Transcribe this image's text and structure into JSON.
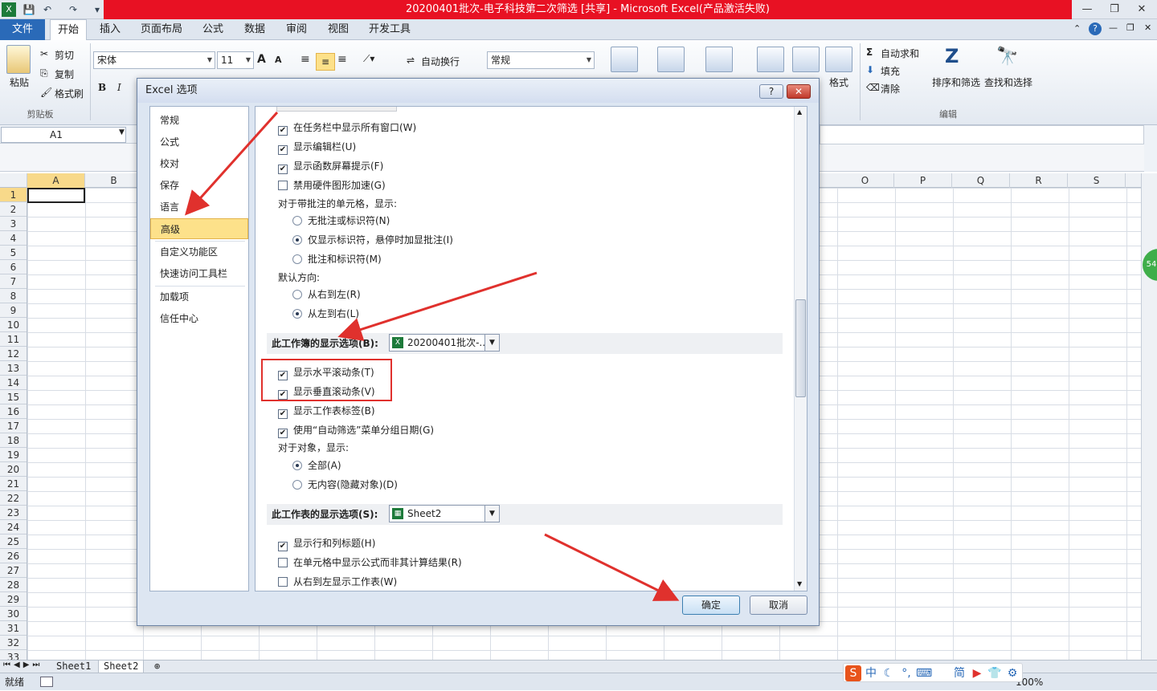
{
  "window": {
    "title": "20200401批次-电子科技第二次筛选  [共享] - Microsoft Excel(产品激活失败)"
  },
  "ribbon": {
    "tabs": [
      "文件",
      "开始",
      "插入",
      "页面布局",
      "公式",
      "数据",
      "审阅",
      "视图",
      "开发工具"
    ],
    "clipboard": {
      "paste": "粘贴",
      "cut": "剪切",
      "copy": "复制",
      "format_painter": "格式刷",
      "group": "剪贴板"
    },
    "font": {
      "name": "宋体",
      "size": "11",
      "bold": "B",
      "italic": "I"
    },
    "alignment": {
      "wrap_text": "自动换行"
    },
    "number": {
      "format": "常规"
    },
    "cells": {
      "format": "格式"
    },
    "editing": {
      "autosum": "自动求和",
      "fill": "填充",
      "clear": "清除",
      "sort_filter": "排序和筛选",
      "find_select": "查找和选择",
      "group": "编辑"
    }
  },
  "formula_bar": {
    "name_box": "A1"
  },
  "sheet": {
    "columns_left": [
      "A",
      "B"
    ],
    "columns_right": [
      "O",
      "P",
      "Q",
      "R",
      "S"
    ],
    "rows": [
      "1",
      "2",
      "3",
      "4",
      "5",
      "6",
      "7",
      "8",
      "9",
      "10",
      "11",
      "12",
      "13",
      "14",
      "15",
      "16",
      "17",
      "18",
      "19",
      "20",
      "21",
      "22",
      "23",
      "24",
      "25",
      "26",
      "27",
      "28",
      "29",
      "30",
      "31",
      "32",
      "33"
    ],
    "tabs": [
      "Sheet1",
      "Sheet2"
    ]
  },
  "status": {
    "ready": "就绪",
    "zoom": "100%"
  },
  "dialog": {
    "title": "Excel 选项",
    "help_button": "?",
    "close_button": "✕",
    "nav": [
      "常规",
      "公式",
      "校对",
      "保存",
      "语言",
      "高级",
      "自定义功能区",
      "快速访问工具栏",
      "加载项",
      "信任中心"
    ],
    "active_nav": "高级",
    "options_top": [
      {
        "label": "在任务栏中显示所有窗口(W)",
        "checked": true
      },
      {
        "label": "显示编辑栏(U)",
        "checked": true
      },
      {
        "label": "显示函数屏幕提示(F)",
        "checked": true
      },
      {
        "label": "禁用硬件图形加速(G)",
        "checked": false
      }
    ],
    "comments_label": "对于带批注的单元格，显示:",
    "comments_radios": [
      {
        "label": "无批注或标识符(N)",
        "checked": false
      },
      {
        "label": "仅显示标识符，悬停时加显批注(I)",
        "checked": true
      },
      {
        "label": "批注和标识符(M)",
        "checked": false
      }
    ],
    "direction_label": "默认方向:",
    "direction_radios": [
      {
        "label": "从右到左(R)",
        "checked": false
      },
      {
        "label": "从左到右(L)",
        "checked": true
      }
    ],
    "workbook_section": {
      "title": "此工作簿的显示选项(B):",
      "value": "20200401批次-..."
    },
    "workbook_options": [
      {
        "label": "显示水平滚动条(T)",
        "checked": true
      },
      {
        "label": "显示垂直滚动条(V)",
        "checked": true
      },
      {
        "label": "显示工作表标签(B)",
        "checked": true
      },
      {
        "label": "使用“自动筛选”菜单分组日期(G)",
        "checked": true
      }
    ],
    "objects_label": "对于对象，显示:",
    "objects_radios": [
      {
        "label": "全部(A)",
        "checked": true
      },
      {
        "label": "无内容(隐藏对象)(D)",
        "checked": false
      }
    ],
    "sheet_section": {
      "title": "此工作表的显示选项(S):",
      "value": "Sheet2"
    },
    "sheet_options": [
      {
        "label": "显示行和列标题(H)",
        "checked": true
      },
      {
        "label": "在单元格中显示公式而非其计算结果(R)",
        "checked": false
      },
      {
        "label": "从右到左显示工作表(W)",
        "checked": false
      }
    ],
    "ok": "确定",
    "cancel": "取消"
  },
  "ime": {
    "mode": "中",
    "simplified": "简"
  },
  "side_badge": "54",
  "colors": {
    "title_red": "#e81123",
    "annotation_red": "#e0312d",
    "nav_active": "#fde18a"
  }
}
